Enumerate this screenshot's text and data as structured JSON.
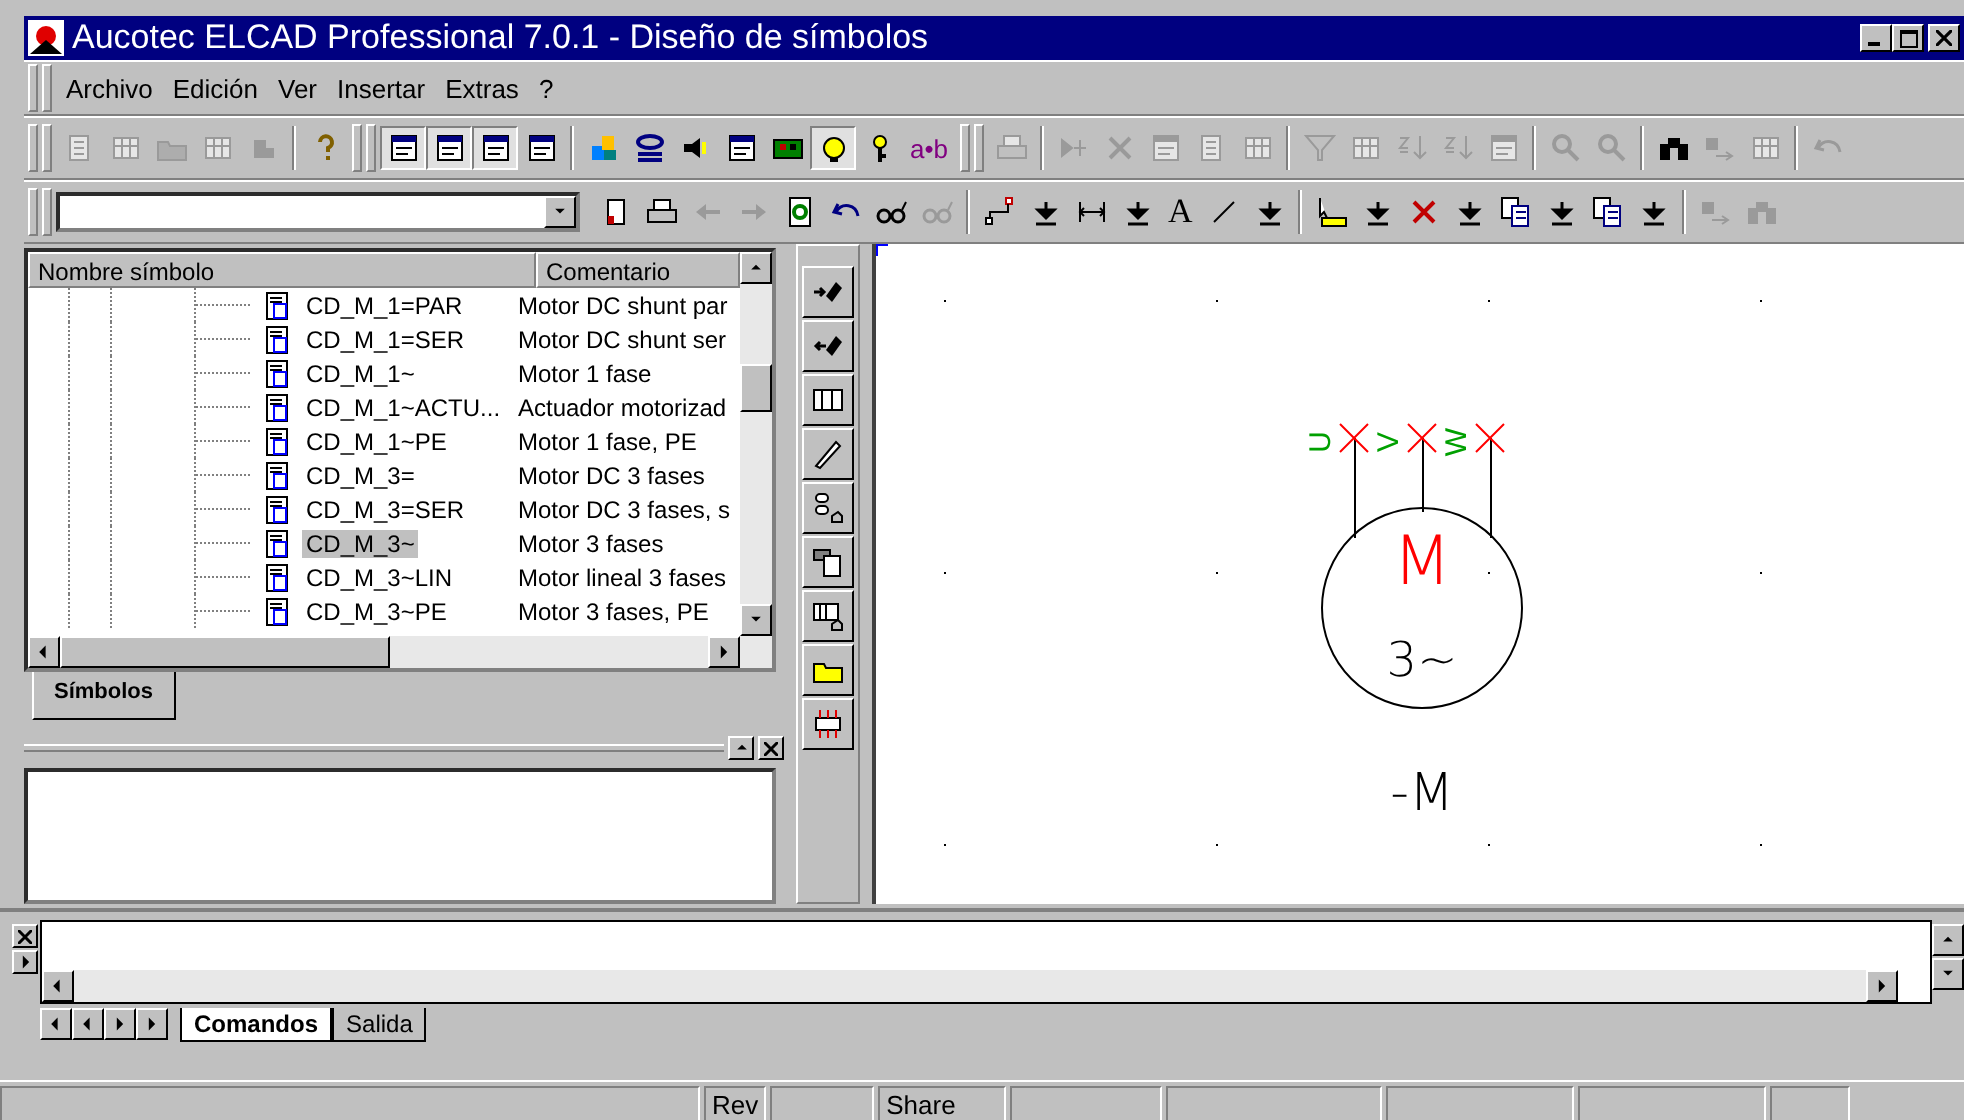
{
  "window": {
    "title": "Aucotec ELCAD Professional 7.0.1 - Diseño de símbolos"
  },
  "menu": [
    {
      "label": "Archivo"
    },
    {
      "label": "Edición"
    },
    {
      "label": "Ver"
    },
    {
      "label": "Insertar"
    },
    {
      "label": "Extras"
    },
    {
      "label": "?"
    }
  ],
  "toolbar_1": [
    {
      "kind": "new",
      "disabled": true,
      "pressed": false
    },
    {
      "kind": "grid",
      "disabled": true,
      "pressed": false
    },
    {
      "kind": "open",
      "disabled": true,
      "pressed": false
    },
    {
      "kind": "grid",
      "disabled": true,
      "pressed": false
    },
    {
      "kind": "tool",
      "disabled": true,
      "pressed": false
    },
    {
      "kind": "separator"
    },
    {
      "kind": "help",
      "disabled": false,
      "pressed": false
    },
    {
      "kind": "grip"
    },
    {
      "kind": "view",
      "disabled": false,
      "pressed": true
    },
    {
      "kind": "view",
      "disabled": false,
      "pressed": true
    },
    {
      "kind": "view",
      "disabled": false,
      "pressed": true
    },
    {
      "kind": "view",
      "disabled": false,
      "pressed": false
    },
    {
      "kind": "separator"
    },
    {
      "kind": "cubes",
      "disabled": false,
      "pressed": false
    },
    {
      "kind": "link",
      "disabled": false,
      "pressed": false
    },
    {
      "kind": "speaker",
      "disabled": false,
      "pressed": false
    },
    {
      "kind": "window",
      "disabled": false,
      "pressed": false
    },
    {
      "kind": "board",
      "disabled": false,
      "pressed": false
    },
    {
      "kind": "bulb",
      "disabled": false,
      "pressed": true
    },
    {
      "kind": "key",
      "disabled": false,
      "pressed": false
    },
    {
      "kind": "text",
      "label": "a•b",
      "disabled": false,
      "pressed": false
    },
    {
      "kind": "grip"
    },
    {
      "kind": "printer",
      "disabled": true,
      "pressed": false
    },
    {
      "kind": "separator"
    },
    {
      "kind": "star",
      "disabled": true,
      "pressed": false
    },
    {
      "kind": "delete",
      "disabled": true,
      "pressed": false
    },
    {
      "kind": "window",
      "disabled": true,
      "pressed": false
    },
    {
      "kind": "new",
      "disabled": true,
      "pressed": false
    },
    {
      "kind": "grid",
      "disabled": true,
      "pressed": false
    },
    {
      "kind": "separator"
    },
    {
      "kind": "filter",
      "disabled": true,
      "pressed": false
    },
    {
      "kind": "grid",
      "disabled": true,
      "pressed": false
    },
    {
      "kind": "sort",
      "disabled": true,
      "pressed": false
    },
    {
      "kind": "sort",
      "disabled": true,
      "pressed": false
    },
    {
      "kind": "window",
      "disabled": true,
      "pressed": false
    },
    {
      "kind": "separator"
    },
    {
      "kind": "zoom",
      "disabled": true,
      "pressed": false
    },
    {
      "kind": "zoom",
      "disabled": true,
      "pressed": false
    },
    {
      "kind": "separator"
    },
    {
      "kind": "binoculars",
      "disabled": false,
      "pressed": false
    },
    {
      "kind": "find-next",
      "disabled": true,
      "pressed": false
    },
    {
      "kind": "grid",
      "disabled": true,
      "pressed": false
    },
    {
      "kind": "separator"
    },
    {
      "kind": "undo",
      "disabled": true,
      "pressed": false
    }
  ],
  "toolbar_2": [
    {
      "kind": "book",
      "disabled": false,
      "pressed": false
    },
    {
      "kind": "printer",
      "disabled": false,
      "pressed": false
    },
    {
      "kind": "left",
      "disabled": true,
      "pressed": false
    },
    {
      "kind": "right",
      "disabled": true,
      "pressed": false
    },
    {
      "kind": "refresh",
      "disabled": false,
      "pressed": false
    },
    {
      "kind": "undo",
      "disabled": false,
      "pressed": false
    },
    {
      "kind": "glasses",
      "disabled": false,
      "pressed": false
    },
    {
      "kind": "glasses",
      "disabled": true,
      "pressed": false
    },
    {
      "kind": "separator"
    },
    {
      "kind": "node",
      "disabled": false,
      "pressed": false
    },
    {
      "kind": "drop",
      "disabled": false,
      "pressed": false
    },
    {
      "kind": "dimension",
      "disabled": false,
      "pressed": false
    },
    {
      "kind": "drop",
      "disabled": false,
      "pressed": false
    },
    {
      "kind": "text",
      "label": "A",
      "disabled": false,
      "pressed": false
    },
    {
      "kind": "line",
      "disabled": false,
      "pressed": false
    },
    {
      "kind": "drop",
      "disabled": false,
      "pressed": false
    },
    {
      "kind": "separator"
    },
    {
      "kind": "select",
      "disabled": false,
      "pressed": false
    },
    {
      "kind": "drop",
      "disabled": false,
      "pressed": false
    },
    {
      "kind": "delete",
      "disabled": false,
      "pressed": false
    },
    {
      "kind": "drop",
      "disabled": false,
      "pressed": false
    },
    {
      "kind": "copy",
      "disabled": false,
      "pressed": false
    },
    {
      "kind": "drop",
      "disabled": false,
      "pressed": false
    },
    {
      "kind": "copy",
      "disabled": false,
      "pressed": false
    },
    {
      "kind": "drop",
      "disabled": false,
      "pressed": false
    },
    {
      "kind": "separator"
    },
    {
      "kind": "find-next",
      "disabled": true,
      "pressed": false
    },
    {
      "kind": "binoculars",
      "disabled": true,
      "pressed": false
    }
  ],
  "symbol_list": {
    "columns": [
      "Nombre símbolo",
      "Comentario"
    ],
    "rows": [
      {
        "name": "CD_M_1=PAR",
        "comment": "Motor DC shunt par",
        "selected": false
      },
      {
        "name": "CD_M_1=SER",
        "comment": "Motor DC shunt ser",
        "selected": false
      },
      {
        "name": "CD_M_1~",
        "comment": "Motor 1 fase",
        "selected": false
      },
      {
        "name": "CD_M_1~ACTU...",
        "comment": "Actuador motorizad",
        "selected": false
      },
      {
        "name": "CD_M_1~PE",
        "comment": "Motor 1 fase, PE",
        "selected": false
      },
      {
        "name": "CD_M_3=",
        "comment": "Motor DC 3 fases",
        "selected": false
      },
      {
        "name": "CD_M_3=SER",
        "comment": "Motor DC 3 fases, s",
        "selected": false
      },
      {
        "name": "CD_M_3~",
        "comment": "Motor 3 fases",
        "selected": true
      },
      {
        "name": "CD_M_3~LIN",
        "comment": "Motor lineal 3 fases",
        "selected": false
      },
      {
        "name": "CD_M_3~PE",
        "comment": "Motor 3 fases, PE",
        "selected": false
      }
    ],
    "tabs": [
      {
        "label": "Símbolos",
        "selected": true
      }
    ]
  },
  "side_toolbar": [
    {
      "kind": "pin-in"
    },
    {
      "kind": "pin-out"
    },
    {
      "kind": "table"
    },
    {
      "kind": "pencil"
    },
    {
      "kind": "shapes"
    },
    {
      "kind": "component"
    },
    {
      "kind": "table-edit"
    },
    {
      "kind": "folder"
    },
    {
      "kind": "connector"
    }
  ],
  "canvas": {
    "pins": [
      "U",
      "V",
      "W"
    ],
    "symbol_letter": "M",
    "phases": "3~",
    "designation": "-M"
  },
  "output_panel": {
    "tabs": [
      {
        "label": "Comandos",
        "selected": true
      },
      {
        "label": "Salida",
        "selected": false
      }
    ]
  },
  "status_bar": {
    "cells": [
      "Rev",
      "Share"
    ]
  }
}
